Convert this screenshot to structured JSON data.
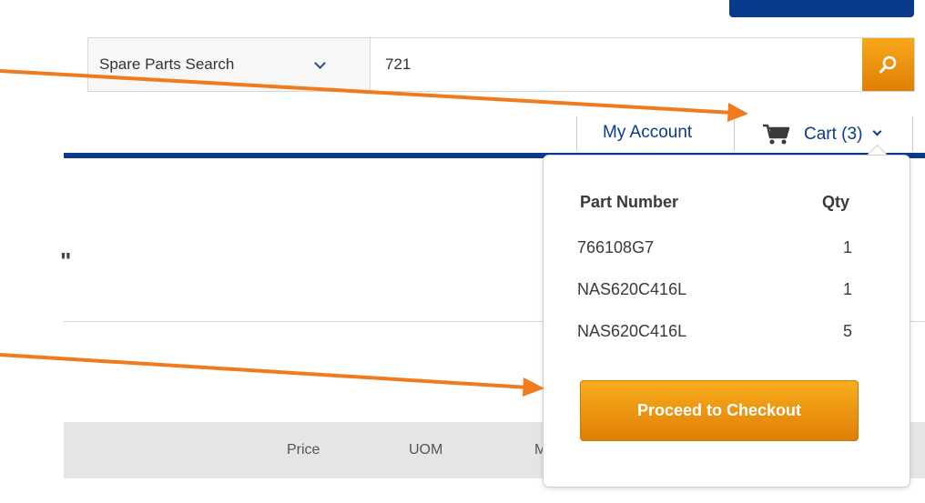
{
  "search": {
    "category_label": "Spare Parts Search",
    "query_value": "721",
    "button_icon": "search-icon"
  },
  "header_nav": {
    "account_label": "My Account",
    "cart_label": "Cart (3)",
    "cart_icon": "shopping-cart-icon"
  },
  "page": {
    "title_fragment": "\"",
    "table_headers": [
      "Price",
      "UOM",
      "M"
    ]
  },
  "cart_dropdown": {
    "headers": {
      "part_number": "Part Number",
      "qty": "Qty"
    },
    "items": [
      {
        "part_number": "766108G7",
        "qty": "1"
      },
      {
        "part_number": "NAS620C416L",
        "qty": "1"
      },
      {
        "part_number": "NAS620C416L",
        "qty": "5"
      }
    ],
    "checkout_label": "Proceed to Checkout"
  },
  "colors": {
    "brand_blue": "#0a3a8c",
    "accent_orange": "#f39a12",
    "annotation_arrow": "#f07a1e"
  }
}
